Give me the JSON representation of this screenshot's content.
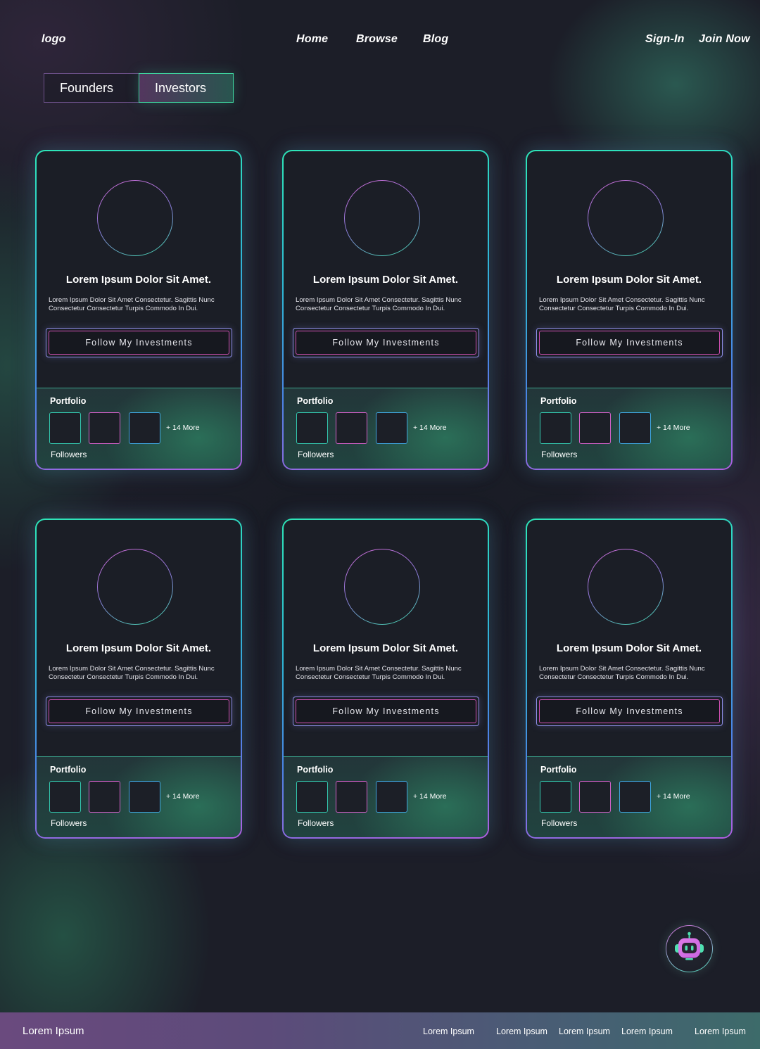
{
  "nav": {
    "logo": "logo",
    "links": [
      "Home",
      "Browse",
      "Blog"
    ],
    "sign_in": "Sign-In",
    "join_now": "Join Now"
  },
  "tabs": [
    "Founders",
    "Investors"
  ],
  "active_tab": "Investors",
  "cards": [
    {
      "title": "Lorem Ipsum Dolor Sit Amet.",
      "description": "Lorem Ipsum Dolor Sit Amet Consectetur. Sagittis Nunc Consectetur Consectetur Turpis Commodo In Dui.",
      "button": "Follow My Investments",
      "portfolio_label": "Portfolio",
      "more": "+ 14 More",
      "followers": "Followers"
    },
    {
      "title": "Lorem Ipsum Dolor Sit Amet.",
      "description": "Lorem Ipsum Dolor Sit Amet Consectetur. Sagittis Nunc Consectetur Consectetur Turpis Commodo In Dui.",
      "button": "Follow My Investments",
      "portfolio_label": "Portfolio",
      "more": "+ 14 More",
      "followers": "Followers"
    },
    {
      "title": "Lorem Ipsum Dolor Sit Amet.",
      "description": "Lorem Ipsum Dolor Sit Amet Consectetur. Sagittis Nunc Consectetur Consectetur Turpis Commodo In Dui.",
      "button": "Follow My Investments",
      "portfolio_label": "Portfolio",
      "more": "+ 14 More",
      "followers": "Followers"
    },
    {
      "title": "Lorem Ipsum Dolor Sit Amet.",
      "description": "Lorem Ipsum Dolor Sit Amet Consectetur. Sagittis Nunc Consectetur Consectetur Turpis Commodo In Dui.",
      "button": "Follow My Investments",
      "portfolio_label": "Portfolio",
      "more": "+ 14 More",
      "followers": "Followers"
    },
    {
      "title": "Lorem Ipsum Dolor Sit Amet.",
      "description": "Lorem Ipsum Dolor Sit Amet Consectetur. Sagittis Nunc Consectetur Consectetur Turpis Commodo In Dui.",
      "button": "Follow My Investments",
      "portfolio_label": "Portfolio",
      "more": "+ 14 More",
      "followers": "Followers"
    },
    {
      "title": "Lorem Ipsum Dolor Sit Amet.",
      "description": "Lorem Ipsum Dolor Sit Amet Consectetur. Sagittis Nunc Consectetur Consectetur Turpis Commodo In Dui.",
      "button": "Follow My Investments",
      "portfolio_label": "Portfolio",
      "more": "+ 14 More",
      "followers": "Followers"
    }
  ],
  "chatbot": {
    "icon": "robot-icon"
  },
  "footer": {
    "brand": "Lorem Ipsum",
    "links": [
      "Lorem Ipsum",
      "Lorem Ipsum",
      "Lorem Ipsum",
      "Lorem Ipsum",
      "Lorem Ipsum"
    ]
  },
  "colors": {
    "background": "#1c1e28",
    "accent_teal": "#2ee6b8",
    "accent_pink": "#d04fb2",
    "accent_violet": "#b05ee0",
    "footer_start": "#6a4a7e",
    "footer_end": "#3d6b6a"
  }
}
